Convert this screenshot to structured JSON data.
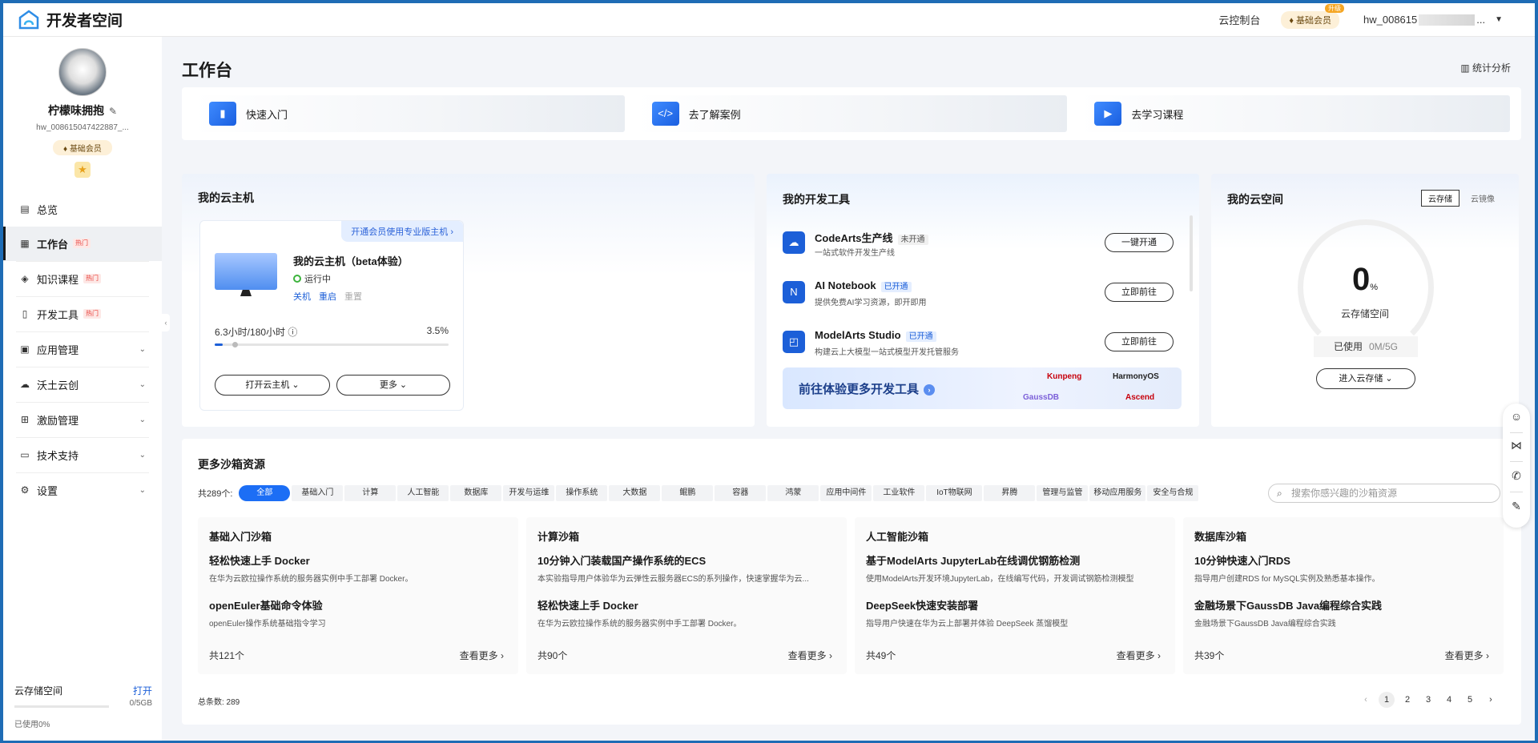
{
  "topbar": {
    "app_title": "开发者空间",
    "console_link": "云控制台",
    "member_label": "基础会员",
    "member_up_tag": "升级",
    "user_name_prefix": "hw_008615",
    "user_name_suffix": "..."
  },
  "sidebar": {
    "nickname": "柠檬味拥抱",
    "user_id": "hw_008615047422887_...",
    "member_label": "基础会员",
    "items": [
      {
        "label": "总览",
        "icon": "overview-icon",
        "hot": "",
        "expand": false
      },
      {
        "label": "工作台",
        "icon": "workbench-icon",
        "hot": "热门",
        "expand": false,
        "active": true
      },
      {
        "label": "知识课程",
        "icon": "course-icon",
        "hot": "热门",
        "expand": false
      },
      {
        "label": "开发工具",
        "icon": "tools-icon",
        "hot": "热门",
        "expand": false
      },
      {
        "label": "应用管理",
        "icon": "app-icon",
        "hot": "",
        "expand": true
      },
      {
        "label": "沃土云创",
        "icon": "cloud-icon",
        "hot": "",
        "expand": true
      },
      {
        "label": "激励管理",
        "icon": "gift-icon",
        "hot": "",
        "expand": true
      },
      {
        "label": "技术支持",
        "icon": "support-icon",
        "hot": "",
        "expand": true
      },
      {
        "label": "设置",
        "icon": "gear-icon",
        "hot": "",
        "expand": true
      }
    ],
    "storage": {
      "title": "云存储空间",
      "open_label": "打开",
      "capacity": "0/5GB",
      "used_text": "已使用0%",
      "used_fraction": 0
    }
  },
  "main": {
    "page_title": "工作台",
    "stats_label": "统计分析",
    "quick_links": [
      {
        "label": "快速入门",
        "icon": "mobile-icon"
      },
      {
        "label": "去了解案例",
        "icon": "code-icon"
      },
      {
        "label": "去学习课程",
        "icon": "play-icon"
      }
    ]
  },
  "vm": {
    "title": "我的云主机",
    "promo": "开通会员使用专业版主机",
    "name": "我的云主机（beta体验）",
    "status": "运行中",
    "actions": [
      "关机",
      "重启",
      "重置"
    ],
    "usage": "6.3小时/180小时",
    "percent": "3.5%",
    "usage_fraction": 0.035,
    "open_button": "打开云主机",
    "more_button": "更多"
  },
  "tools": {
    "title": "我的开发工具",
    "items": [
      {
        "name": "CodeArts生产线",
        "status": "未开通",
        "desc": "一站式软件开发生产线",
        "button": "一键开通",
        "icon": "codearts-icon"
      },
      {
        "name": "AI Notebook",
        "status": "已开通",
        "desc": "提供免费AI学习资源，即开即用",
        "button": "立即前往",
        "icon": "notebook-icon"
      },
      {
        "name": "ModelArts Studio",
        "status": "已开通",
        "desc": "构建云上大模型一站式模型开发托管服务",
        "button": "立即前往",
        "icon": "modelarts-icon"
      }
    ],
    "banner": "前往体验更多开发工具",
    "banner_logos": [
      "Kunpeng",
      "HarmonyOS",
      "GaussDB",
      "Ascend"
    ]
  },
  "space": {
    "title": "我的云空间",
    "tab_active": "云存储",
    "tab_other": "云镜像",
    "value": "0",
    "unit": "%",
    "label": "云存储空间",
    "used_label": "已使用",
    "used_value": "0M/5G",
    "enter_button": "进入云存储"
  },
  "sandbox": {
    "title": "更多沙箱资源",
    "count_label": "共289个:",
    "filters": [
      "全部",
      "基础入门",
      "计算",
      "人工智能",
      "数据库",
      "开发与运维",
      "操作系统",
      "大数据",
      "鲲鹏",
      "容器",
      "鸿蒙",
      "应用中间件",
      "工业软件",
      "IoT物联网",
      "昇腾",
      "管理与监管",
      "移动应用服务",
      "安全与合规"
    ],
    "search_placeholder": "搜索你感兴趣的沙箱资源",
    "categories": [
      {
        "title": "基础入门沙箱",
        "items": [
          {
            "name": "轻松快速上手 Docker",
            "desc": "在华为云欧拉操作系统的服务器实例中手工部署 Docker。"
          },
          {
            "name": "openEuler基础命令体验",
            "desc": "openEuler操作系统基础指令学习"
          }
        ],
        "count": "共121个",
        "more": "查看更多"
      },
      {
        "title": "计算沙箱",
        "items": [
          {
            "name": "10分钟入门装载国产操作系统的ECS",
            "desc": "本实验指导用户体验华为云弹性云服务器ECS的系列操作，快速掌握华为云..."
          },
          {
            "name": "轻松快速上手 Docker",
            "desc": "在华为云欧拉操作系统的服务器实例中手工部署 Docker。"
          }
        ],
        "count": "共90个",
        "more": "查看更多"
      },
      {
        "title": "人工智能沙箱",
        "items": [
          {
            "name": "基于ModelArts JupyterLab在线调优钢筋检测",
            "desc": "使用ModelArts开发环境JupyterLab，在线编写代码，开发调试钢筋检测模型"
          },
          {
            "name": "DeepSeek快速安装部署",
            "desc": "指导用户快速在华为云上部署并体验 DeepSeek 蒸馏模型"
          }
        ],
        "count": "共49个",
        "more": "查看更多"
      },
      {
        "title": "数据库沙箱",
        "items": [
          {
            "name": "10分钟快速入门RDS",
            "desc": "指导用户创建RDS for MySQL实例及熟悉基本操作。"
          },
          {
            "name": "金融场景下GaussDB Java编程综合实践",
            "desc": "金融场景下GaussDB Java编程综合实践"
          }
        ],
        "count": "共39个",
        "more": "查看更多"
      }
    ],
    "total_label": "总条数:  289",
    "pages": [
      "1",
      "2",
      "3",
      "4",
      "5"
    ]
  },
  "float_icons": [
    "smile-icon",
    "share-icon",
    "phone-icon",
    "feedback-icon"
  ]
}
